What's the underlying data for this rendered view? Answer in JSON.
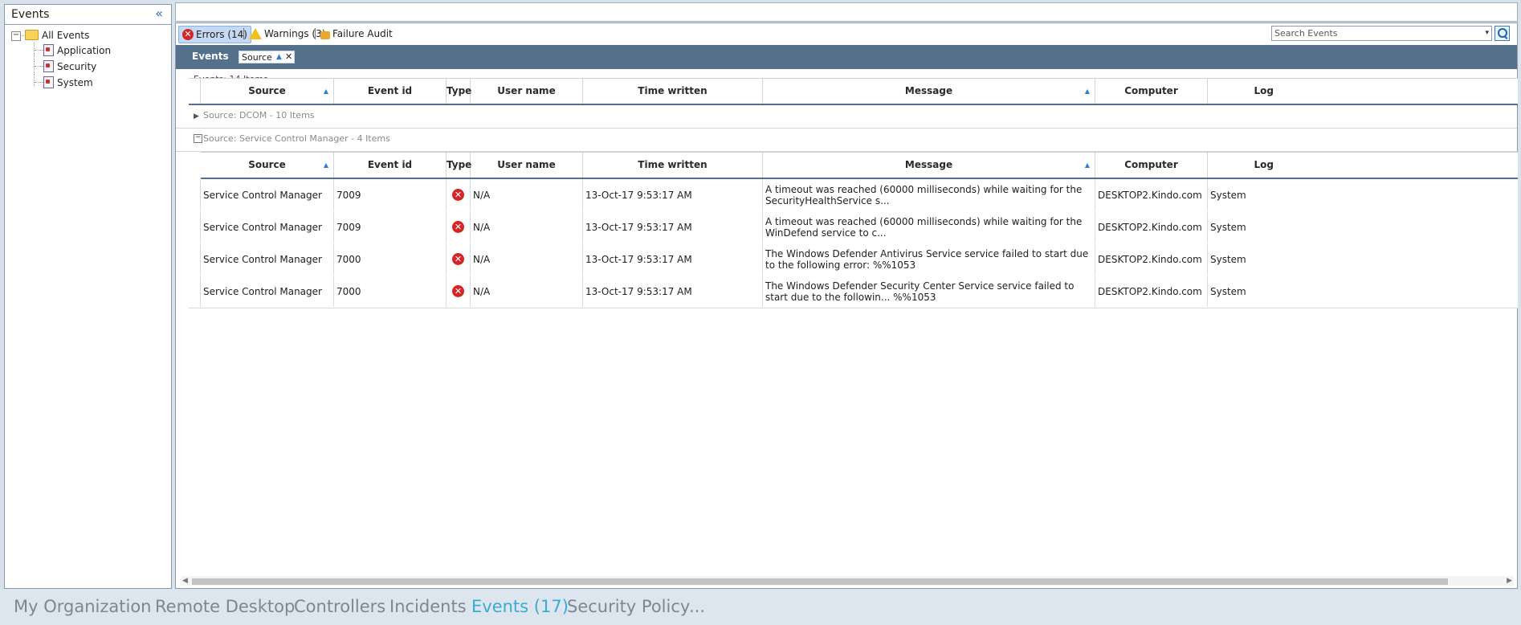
{
  "left_panel": {
    "title": "Events",
    "collapse_glyph": "«",
    "tree": {
      "root": "All Events",
      "children": [
        "Application",
        "Security",
        "System"
      ]
    }
  },
  "filters": {
    "errors": "Errors (14)",
    "warnings": "Warnings (3)",
    "failure_audit": "Failure Audit"
  },
  "search": {
    "placeholder": "Search Events",
    "dropdown_glyph": "▾"
  },
  "group_bar": {
    "label": "Events",
    "chip_label": "Source",
    "chip_sort": "▲",
    "chip_close": "✕"
  },
  "count_label": "Events: 14 Items",
  "columns": {
    "source": "Source",
    "event_id": "Event id",
    "type": "Type",
    "user_name": "User name",
    "time_written": "Time written",
    "message": "Message",
    "computer": "Computer",
    "log": "Log"
  },
  "sort_glyph": "▲",
  "groups": [
    {
      "label": "Source: DCOM - 10 Items",
      "expander": "▶"
    },
    {
      "label": "Source: Service Control Manager - 4 Items",
      "expander": "−"
    }
  ],
  "rows": [
    {
      "source": "Service Control Manager",
      "event_id": "7009",
      "type_glyph": "✕",
      "user": "N/A",
      "time": "13-Oct-17 9:53:17 AM",
      "message": "A timeout was reached (60000 milliseconds) while waiting for the SecurityHealthService s...",
      "computer": "DESKTOP2.Kindo.com",
      "log": "System"
    },
    {
      "source": "Service Control Manager",
      "event_id": "7009",
      "type_glyph": "✕",
      "user": "N/A",
      "time": "13-Oct-17 9:53:17 AM",
      "message": "A timeout was reached (60000 milliseconds) while waiting for the WinDefend service to c...",
      "computer": "DESKTOP2.Kindo.com",
      "log": "System"
    },
    {
      "source": "Service Control Manager",
      "event_id": "7000",
      "type_glyph": "✕",
      "user": "N/A",
      "time": "13-Oct-17 9:53:17 AM",
      "message": "The Windows Defender Antivirus Service service failed to start due to the following error: %%1053",
      "computer": "DESKTOP2.Kindo.com",
      "log": "System"
    },
    {
      "source": "Service Control Manager",
      "event_id": "7000",
      "type_glyph": "✕",
      "user": "N/A",
      "time": "13-Oct-17 9:53:17 AM",
      "message": "The Windows Defender Security Center Service service failed to start due to the followin... %%1053",
      "computer": "DESKTOP2.Kindo.com",
      "log": "System"
    }
  ],
  "scroll": {
    "left_glyph": "◀",
    "right_glyph": "▶"
  },
  "bottom_nav": {
    "tabs": [
      "My Organization",
      "Remote Desktop",
      "Controllers",
      "Incidents",
      "Events (17)",
      "Security Policy",
      "..."
    ],
    "active": "Events (17)"
  },
  "colors": {
    "accent": "#3aabd1",
    "group_bar": "#54708a",
    "error": "#d42626"
  }
}
